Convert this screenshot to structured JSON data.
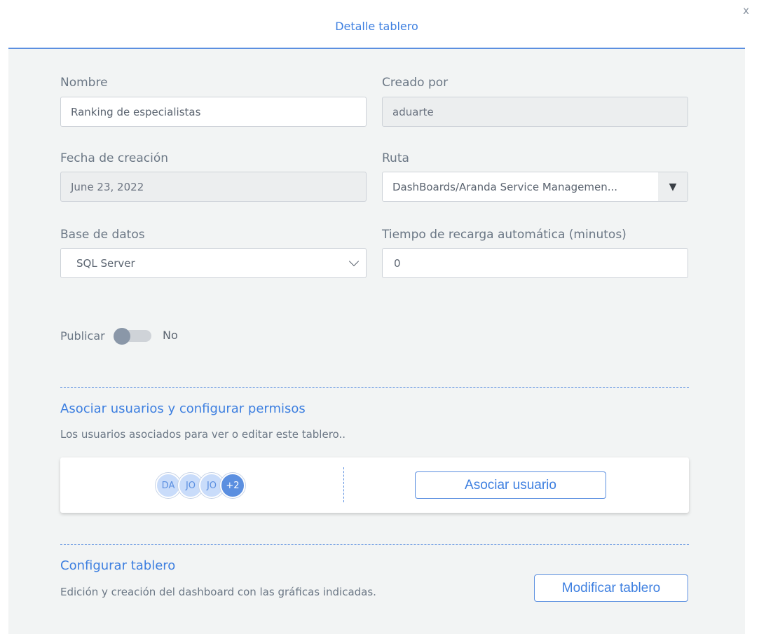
{
  "dialog": {
    "title": "Detalle tablero",
    "close_label": "x"
  },
  "form": {
    "name": {
      "label": "Nombre",
      "value": "Ranking de especialistas"
    },
    "created_by": {
      "label": "Creado por",
      "value": "aduarte"
    },
    "creation_date": {
      "label": "Fecha de creación",
      "value": "June 23, 2022"
    },
    "path": {
      "label": "Ruta",
      "value": "DashBoards/Aranda Service Managemen...",
      "arrow": "▼"
    },
    "database": {
      "label": "Base de datos",
      "value": "SQL Server"
    },
    "reload_time": {
      "label": "Tiempo de recarga automática (minutos)",
      "value": "0"
    }
  },
  "publish": {
    "label": "Publicar",
    "state": "No",
    "enabled": false
  },
  "users_section": {
    "title": "Asociar usuarios y configurar permisos",
    "description": "Los usuarios asociados para ver o editar este tablero..",
    "avatars": [
      "DA",
      "JO",
      "JO"
    ],
    "more_count": "+2",
    "associate_button": "Asociar usuario"
  },
  "configure_section": {
    "title": "Configurar tablero",
    "description": "Edición y creación del dashboard con las gráficas indicadas.",
    "modify_button": "Modificar tablero"
  },
  "colors": {
    "accent": "#3d7fe0",
    "panel_background": "#f2f4f4",
    "toggle_knob_off": "#8a97a8"
  }
}
